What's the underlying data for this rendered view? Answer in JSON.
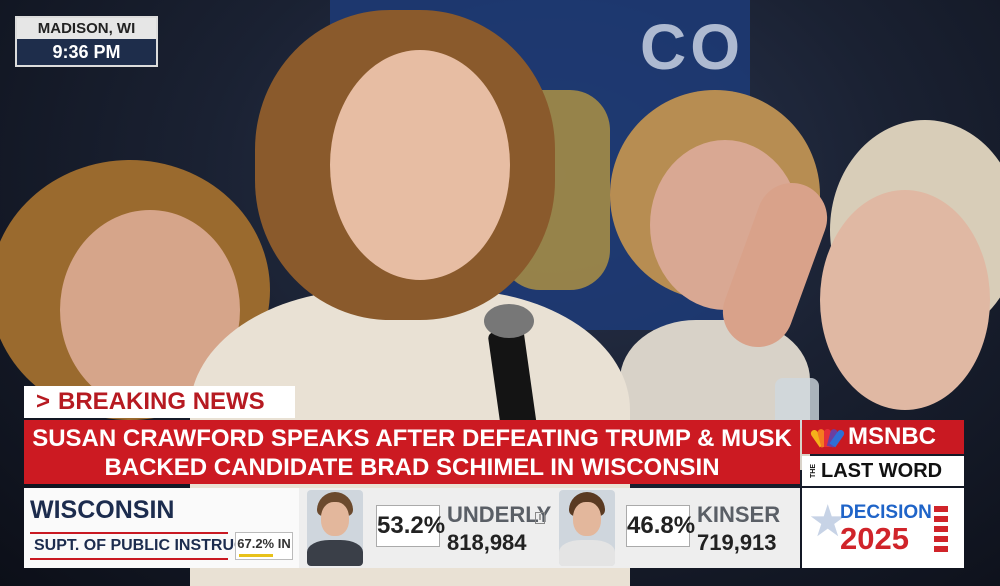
{
  "location_clock": {
    "location": "MADISON, WI",
    "time": "9:36 PM"
  },
  "breaking": {
    "chevron": ">",
    "label": "BREAKING NEWS"
  },
  "headline": {
    "line1": "SUSAN CRAWFORD SPEAKS AFTER DEFEATING TRUMP & MUSK",
    "line2": "BACKED CANDIDATE BRAD SCHIMEL IN WISCONSIN"
  },
  "network": {
    "logo_text": "MSNBC",
    "show_prefix": "THE",
    "show_name": "LAST WORD",
    "accent": "#c91922"
  },
  "race": {
    "state": "WISCONSIN",
    "office": "SUPT. OF PUBLIC INSTRUCTION",
    "reporting": "67.2% IN",
    "reporting_fraction": 0.672
  },
  "candidates": [
    {
      "name": "UNDERLY",
      "percent": "53.2%",
      "votes": "818,984",
      "incumbent_marker": "I"
    },
    {
      "name": "KINSER",
      "percent": "46.8%",
      "votes": "719,913"
    }
  ],
  "branding": {
    "decision_word": "DECISION",
    "decision_year": "2025"
  },
  "colors": {
    "headline_red": "#cc1a22",
    "navy": "#1c2c4e",
    "decision_blue": "#1f64c8"
  }
}
